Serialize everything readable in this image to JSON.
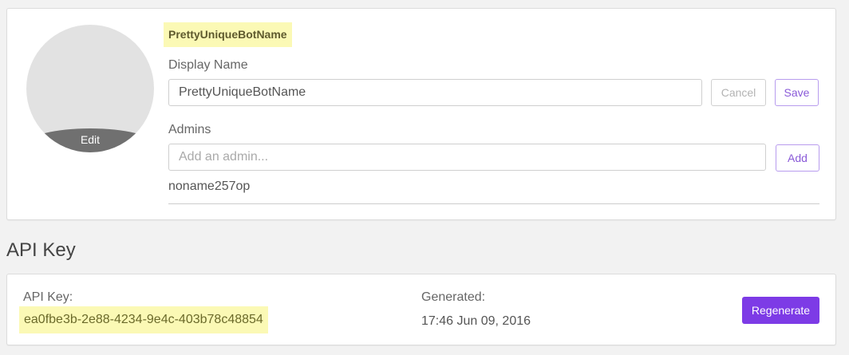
{
  "profile": {
    "avatar_edit_label": "Edit",
    "bot_name": "PrettyUniqueBotName",
    "display_name_label": "Display Name",
    "display_name_value": "PrettyUniqueBotName",
    "cancel_label": "Cancel",
    "save_label": "Save",
    "admins_label": "Admins",
    "admin_placeholder": "Add an admin...",
    "add_label": "Add",
    "admins": [
      "noname257op"
    ]
  },
  "api_key": {
    "section_title": "API Key",
    "label": "API Key:",
    "value": "ea0fbe3b-2e88-4234-9e4c-403b78c48854",
    "generated_label": "Generated:",
    "generated_value": "17:46 Jun 09, 2016",
    "regenerate_label": "Regenerate"
  },
  "colors": {
    "accent": "#7d3be6",
    "highlight": "#fbf9b5",
    "background": "#f2f2f2"
  }
}
